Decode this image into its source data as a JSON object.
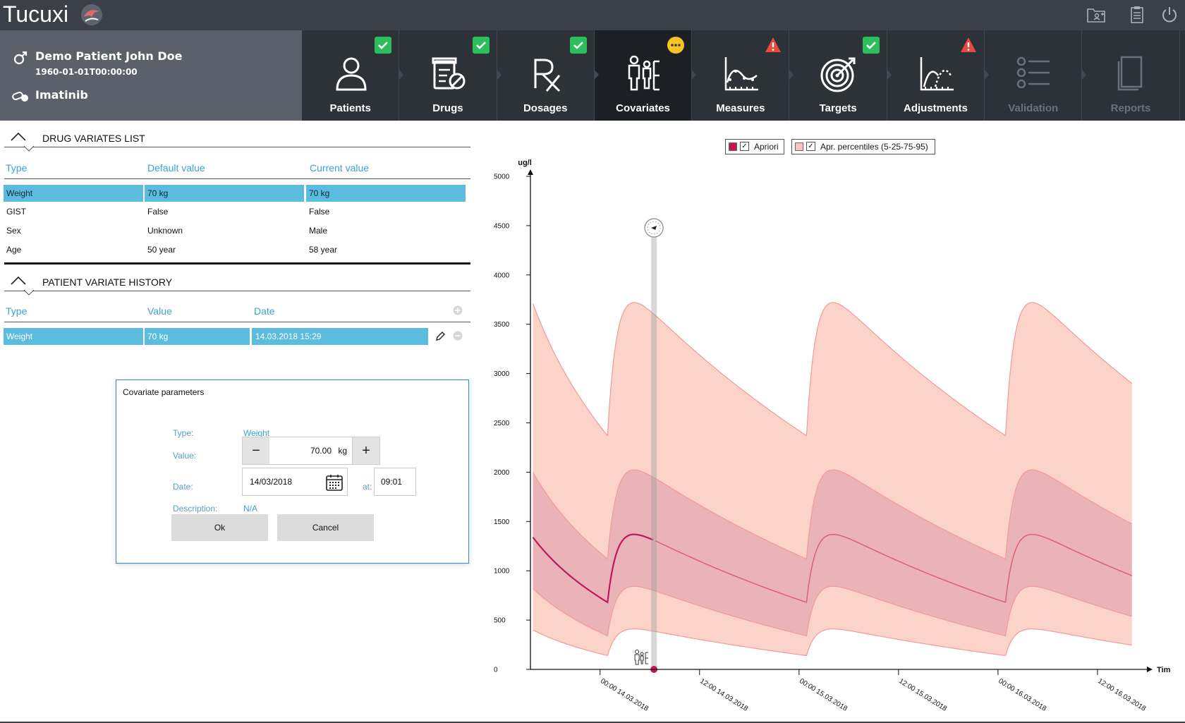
{
  "app": {
    "title": "Tucuxi"
  },
  "patient": {
    "name": "Demo Patient John Doe",
    "dob": "1960-01-01T00:00:00",
    "drug": "Imatinib"
  },
  "tabs": [
    {
      "label": "Patients",
      "icon": "patient-icon",
      "status": "ok"
    },
    {
      "label": "Drugs",
      "icon": "drugs-icon",
      "status": "ok"
    },
    {
      "label": "Dosages",
      "icon": "rx-icon",
      "status": "ok"
    },
    {
      "label": "Covariates",
      "icon": "covariates-icon",
      "status": "pending",
      "active": true
    },
    {
      "label": "Measures",
      "icon": "measures-icon",
      "status": "warning"
    },
    {
      "label": "Targets",
      "icon": "target-icon",
      "status": "ok"
    },
    {
      "label": "Adjustments",
      "icon": "adjustments-icon",
      "status": "warning"
    },
    {
      "label": "Validation",
      "icon": "validation-icon",
      "status": "disabled"
    },
    {
      "label": "Reports",
      "icon": "reports-icon",
      "status": "disabled"
    }
  ],
  "drug_variates": {
    "title": "DRUG VARIATES LIST",
    "columns": [
      "Type",
      "Default value",
      "Current value"
    ],
    "rows": [
      [
        "Weight",
        "70 kg",
        "70 kg"
      ],
      [
        "GIST",
        "False",
        "False"
      ],
      [
        "Sex",
        "Unknown",
        "Male"
      ],
      [
        "Age",
        "50 year",
        "58 year"
      ]
    ]
  },
  "patient_variates": {
    "title": "PATIENT VARIATE HISTORY",
    "columns": [
      "Type",
      "Value",
      "Date"
    ],
    "rows": [
      [
        "Weight",
        "70 kg",
        "14.03.2018 15:29"
      ]
    ]
  },
  "dialog": {
    "title": "Covariate parameters",
    "type_label": "Type:",
    "type_value": "Weight",
    "value_label": "Value:",
    "value": "70.00",
    "unit": "kg",
    "minus": "−",
    "plus": "+",
    "date_label": "Date:",
    "date": "14/03/2018",
    "at_label": "at:",
    "time": "09:01",
    "description_label": "Description:",
    "description": "N/A",
    "ok": "Ok",
    "cancel": "Cancel"
  },
  "legend": {
    "apriori": "Apriori",
    "percentiles": "Apr. percentiles (5-25-75-95)",
    "colors": {
      "apriori": "#c2185b",
      "p5_95": "#fcd3c8",
      "p25_75": "#eab3b8"
    }
  },
  "chart_data": {
    "type": "area",
    "ylabel": "ug/l",
    "xlabel": "Time",
    "ylim": [
      0,
      5000
    ],
    "yticks": [
      0,
      500,
      1000,
      1500,
      2000,
      2500,
      3000,
      3500,
      4000,
      4500,
      5000
    ],
    "xticks": [
      "00:00 14.03.2018",
      "12:00 14.03.2018",
      "00:00 15.03.2018",
      "12:00 15.03.2018",
      "00:00 16.03.2018",
      "12:00 16.03.2018"
    ],
    "x_hours": [
      0,
      12,
      24,
      36,
      48,
      60
    ],
    "x_range_hours": [
      -8.4,
      64.6
    ],
    "dose_times_hours": [
      0.9,
      24.9,
      48.9
    ],
    "marker_time_hours": 6.5,
    "series": [
      {
        "name": "Apriori",
        "start": 1340,
        "trough": 680,
        "peak": 1420,
        "end": 1340
      },
      {
        "name": "p5",
        "start": 400,
        "trough": 140,
        "peak": 430,
        "end": 400
      },
      {
        "name": "p25",
        "start": 820,
        "trough": 340,
        "peak": 880,
        "end": 820
      },
      {
        "name": "p75",
        "start": 2000,
        "trough": 1120,
        "peak": 2090,
        "end": 2000
      },
      {
        "name": "p95",
        "start": 3710,
        "trough": 2370,
        "peak": 3820,
        "end": 3710
      }
    ]
  }
}
